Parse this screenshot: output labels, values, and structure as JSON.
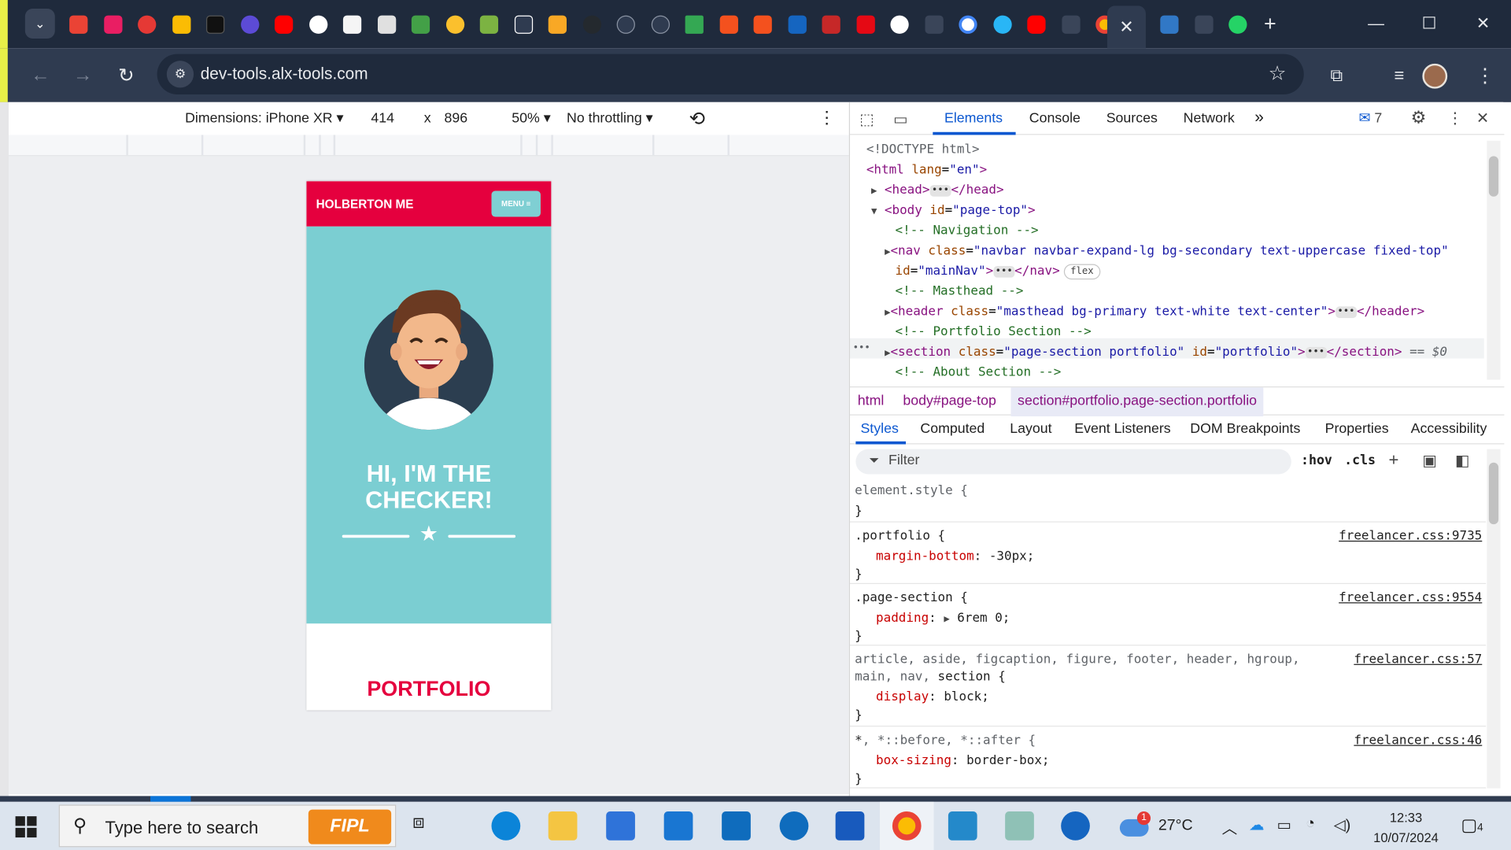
{
  "browser": {
    "address": "dev-tools.alx-tools.com",
    "close_tab_glyph": "✕",
    "new_tab_glyph": "+",
    "window": {
      "minimize": "—",
      "maximize": "☐",
      "close": "✕"
    }
  },
  "device_toolbar": {
    "dimensions_label": "Dimensions: iPhone XR",
    "width": "414",
    "x_sep": "x",
    "height": "896",
    "zoom": "50%",
    "throttling": "No throttling"
  },
  "phone": {
    "brand": "HOLBERTON ME",
    "menu_label": "MENU",
    "heading": "HI, I'M THE CHECKER!",
    "section_title": "PORTFOLIO",
    "colors": {
      "primary": "#e5003e",
      "masthead": "#7bced2"
    }
  },
  "devtools": {
    "tabs": [
      "Elements",
      "Console",
      "Sources",
      "Network"
    ],
    "more_tabs": "»",
    "issues_count": "7",
    "dom": {
      "doctype": "<!DOCTYPE html>",
      "html_open": "<html",
      "html_lang_attr": " lang",
      "html_lang_val": "\"en\"",
      "head_open": "<head>",
      "head_close": "</head>",
      "body_open": "<body",
      "body_id_attr": " id",
      "body_id_val": "\"page-top\"",
      "comment_nav": "<!-- Navigation -->",
      "nav_open": "<nav",
      "class_attr": " class",
      "nav_class_val": "\"navbar navbar-expand-lg bg-secondary text-uppercase fixed-top\"",
      "id_attr": "id",
      "nav_id_val": "\"mainNav\"",
      "nav_close": "</nav>",
      "flex_badge": "flex",
      "comment_masthead": "<!-- Masthead -->",
      "header_open": "<header",
      "header_class_val": "\"masthead bg-primary text-white text-center\"",
      "header_close": "</header>",
      "comment_portfolio": "<!-- Portfolio Section -->",
      "section_open": "<section",
      "section_class_val": "\"page-section portfolio\"",
      "section_id_attr": " id",
      "section_id_val": "\"portfolio\"",
      "section_close": "</section>",
      "selected_marker": "== $0",
      "comment_about": "<!-- About Section -->",
      "gutter": "•••"
    },
    "breadcrumbs": [
      "html",
      "body#page-top",
      "section#portfolio.page-section.portfolio"
    ],
    "sub_tabs": [
      "Styles",
      "Computed",
      "Layout",
      "Event Listeners",
      "DOM Breakpoints",
      "Properties",
      "Accessibility"
    ],
    "filter_placeholder": "Filter",
    "hov": ":hov",
    "cls": ".cls",
    "styles": {
      "element_style": "element.style {",
      "close_brace": "}",
      "r1_selector": ".portfolio {",
      "r1_prop": "margin-bottom",
      "r1_val": "-30px;",
      "r1_src": "freelancer.css:9735",
      "r2_selector": ".page-section {",
      "r2_prop": "padding",
      "r2_val": "6rem 0;",
      "r2_src": "freelancer.css:9554",
      "r3_sel_line1": "article, aside, figcaption, figure, footer, header, hgroup,",
      "r3_sel_line2_a": "main, nav, ",
      "r3_sel_line2_b": "section {",
      "r3_prop": "display",
      "r3_val": "block;",
      "r3_src": "freelancer.css:57",
      "r4_selector_a": "*",
      "r4_selector_b": ", *::before, *::after {",
      "r4_prop": "box-sizing",
      "r4_val": "border-box;",
      "r4_src": "freelancer.css:46"
    }
  },
  "taskbar": {
    "search_placeholder": "Type here to search",
    "fipl": "FIPL",
    "temperature": "27°C",
    "weather_badge": "1",
    "time": "12:33",
    "date": "10/07/2024",
    "notifications": "4"
  }
}
